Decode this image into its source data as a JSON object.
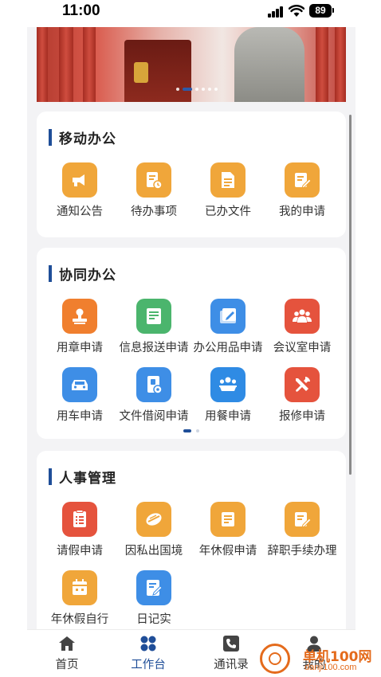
{
  "status_bar": {
    "time": "11:00",
    "battery": "89"
  },
  "banner": {
    "dot_count": 6,
    "active_dot": 1
  },
  "sections": [
    {
      "title": "移动办公",
      "items": [
        {
          "label": "通知公告",
          "icon": "announcement-icon",
          "color": "#f0a63a"
        },
        {
          "label": "待办事项",
          "icon": "pending-doc-icon",
          "color": "#f0a63a"
        },
        {
          "label": "已办文件",
          "icon": "done-file-icon",
          "color": "#f0a63a"
        },
        {
          "label": "我的申请",
          "icon": "my-application-icon",
          "color": "#f0a63a"
        }
      ]
    },
    {
      "title": "协同办公",
      "items": [
        {
          "label": "用章申请",
          "icon": "stamp-icon",
          "color": "#f07f2e"
        },
        {
          "label": "信息报送申请",
          "icon": "info-report-icon",
          "color": "#4bb56d"
        },
        {
          "label": "办公用品申请",
          "icon": "office-supplies-icon",
          "color": "#3e8ee6"
        },
        {
          "label": "会议室申请",
          "icon": "meeting-room-icon",
          "color": "#e5533d"
        },
        {
          "label": "用车申请",
          "icon": "car-icon",
          "color": "#3e8ee6"
        },
        {
          "label": "文件借阅申请",
          "icon": "file-borrow-icon",
          "color": "#3e8ee6"
        },
        {
          "label": "用餐申请",
          "icon": "dining-icon",
          "color": "#2f8be4"
        },
        {
          "label": "报修申请",
          "icon": "repair-icon",
          "color": "#e5533d"
        }
      ]
    },
    {
      "title": "人事管理",
      "items": [
        {
          "label": "请假申请",
          "icon": "leave-request-icon",
          "color": "#e5533d"
        },
        {
          "label": "因私出国境",
          "icon": "travel-abroad-icon",
          "color": "#f0a63a"
        },
        {
          "label": "年休假申请",
          "icon": "annual-leave-icon",
          "color": "#f0a63a"
        },
        {
          "label": "辞职手续办理",
          "icon": "resignation-icon",
          "color": "#f0a63a"
        },
        {
          "label": "年休假自行",
          "icon": "annual-leave-self-icon",
          "color": "#f0a63a"
        },
        {
          "label": "日记实",
          "icon": "diary-icon",
          "color": "#3e8ee6"
        }
      ]
    }
  ],
  "tabbar": [
    {
      "label": "首页",
      "icon": "home-icon"
    },
    {
      "label": "工作台",
      "icon": "workbench-icon",
      "active": true
    },
    {
      "label": "通讯录",
      "icon": "contacts-icon"
    },
    {
      "label": "我的",
      "icon": "profile-icon"
    }
  ],
  "watermark": {
    "cn": "单机100网",
    "en": "danji100.com"
  }
}
